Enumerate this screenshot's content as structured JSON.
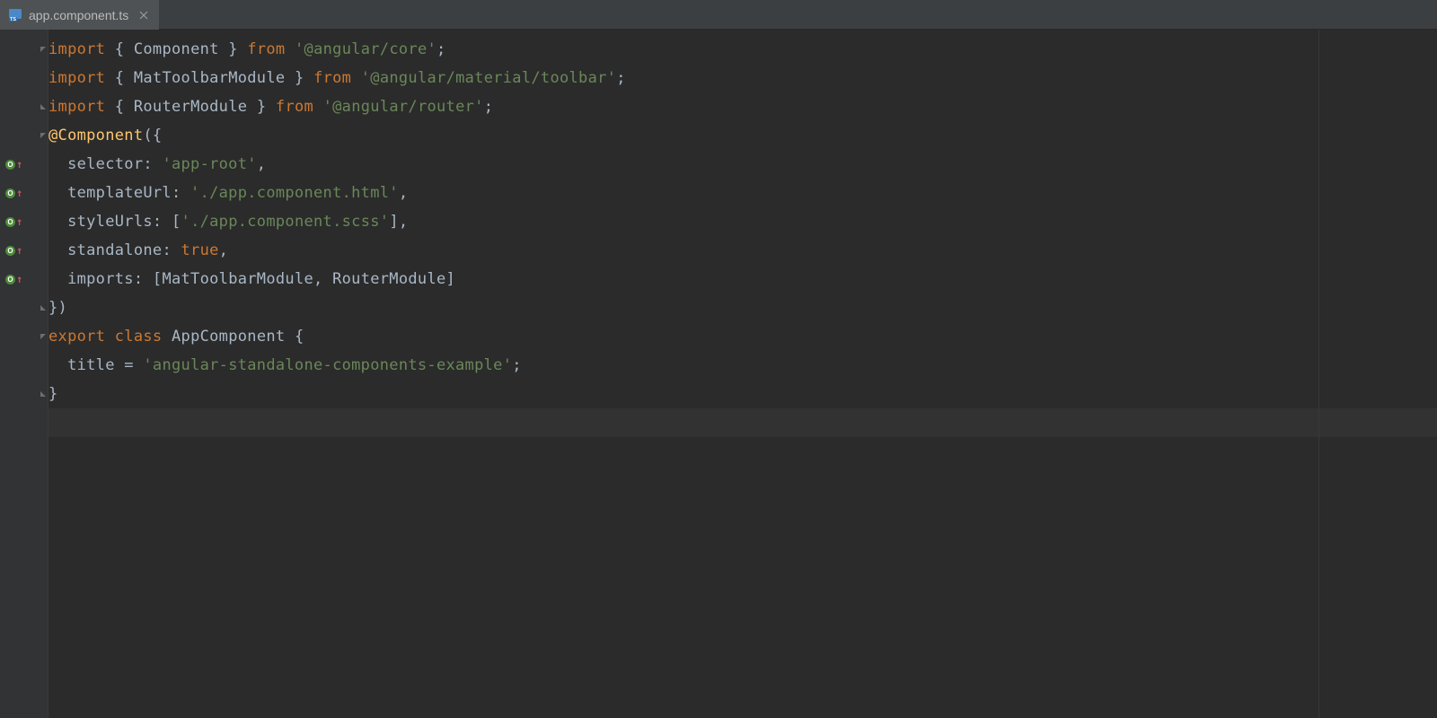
{
  "tab": {
    "filename": "app.component.ts",
    "icon_label": "TS"
  },
  "gutter": {
    "badge_char": "O",
    "badge_arrow": "↑"
  },
  "code": {
    "line1": {
      "kw_import": "import",
      "brace_open": "{",
      "component": "Component",
      "brace_close": "}",
      "kw_from": "from",
      "str_core": "'@angular/core'",
      "semi": ";"
    },
    "line2": {
      "kw_import": "import",
      "brace_open": "{",
      "mat_toolbar": "MatToolbarModule",
      "brace_close": "}",
      "kw_from": "from",
      "str_toolbar": "'@angular/material/toolbar'",
      "semi": ";"
    },
    "line3": {
      "kw_import": "import",
      "brace_open": "{",
      "router": "RouterModule",
      "brace_close": "}",
      "kw_from": "from",
      "str_router": "'@angular/router'",
      "semi": ";"
    },
    "line4": {
      "at": "@",
      "decorator": "Component",
      "paren_open": "(",
      "brace_open": "{"
    },
    "line5": {
      "key": "selector",
      "colon": ": ",
      "val": "'app-root'",
      "comma": ","
    },
    "line6": {
      "key": "templateUrl",
      "colon": ": ",
      "val": "'./app.component.html'",
      "comma": ","
    },
    "line7": {
      "key": "styleUrls",
      "colon": ": ",
      "bracket_open": "[",
      "val": "'./app.component.scss'",
      "bracket_close": "]",
      "comma": ","
    },
    "line8": {
      "key": "standalone",
      "colon": ": ",
      "val": "true",
      "comma": ","
    },
    "line9": {
      "key": "imports",
      "colon": ": ",
      "bracket_open": "[",
      "mat": "MatToolbarModule",
      "sep": ", ",
      "router": "RouterModule",
      "bracket_close": "]"
    },
    "line10": {
      "brace_close": "}",
      "paren_close": ")"
    },
    "line11": {
      "kw_export": "export",
      "kw_class": "class",
      "name": "AppComponent",
      "brace_open": "{"
    },
    "line12": {
      "prop": "title",
      "eq": " = ",
      "val": "'angular-standalone-components-example'",
      "semi": ";"
    },
    "line13": {
      "brace_close": "}"
    }
  }
}
